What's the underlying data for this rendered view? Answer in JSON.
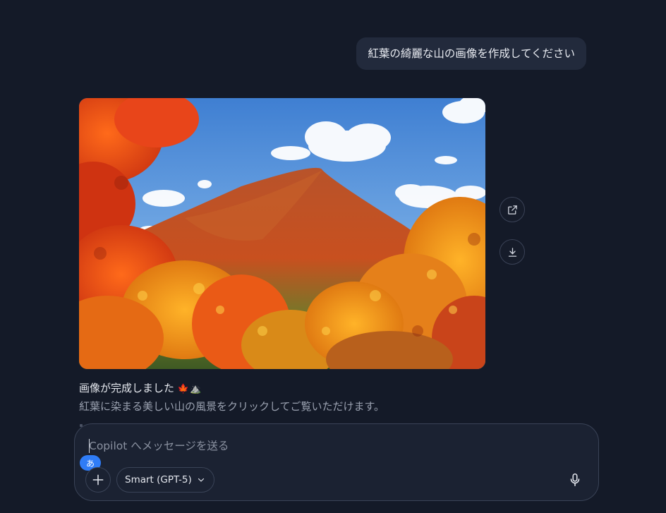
{
  "conversation": {
    "user_message": "紅葉の綺麗な山の画像を作成してください",
    "assistant": {
      "title": "画像が完成しました",
      "title_emoji": "🍁⛰️",
      "body": "紅葉に染まる美しい山の風景をクリックしてご覧いただけます。"
    }
  },
  "image_actions": {
    "share_icon": "share-icon",
    "download_icon": "download-icon"
  },
  "composer": {
    "placeholder": "Copilot へメッセージを送る",
    "ime_indicator": "あ",
    "model_label": "Smart (GPT-5)",
    "plus_icon": "plus-icon",
    "mic_icon": "microphone-icon"
  },
  "colors": {
    "background": "#141a28",
    "bubble": "#222a3c",
    "accent": "#2f7cf6"
  }
}
